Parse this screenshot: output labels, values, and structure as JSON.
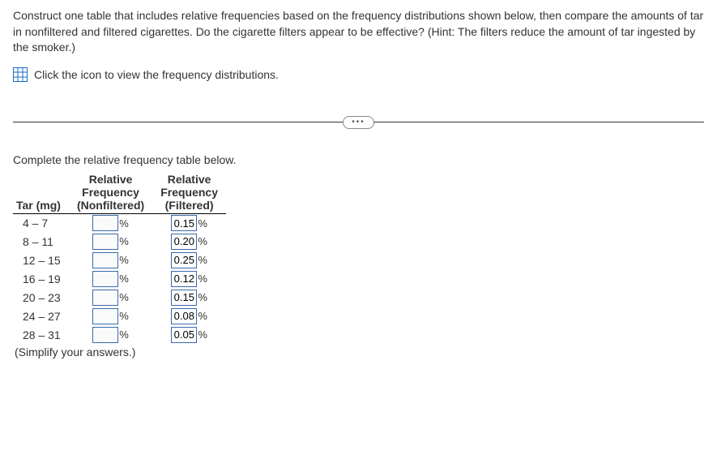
{
  "question": "Construct one table that includes relative frequencies based on the frequency distributions shown below, then compare the amounts of tar in nonfiltered and filtered cigarettes. Do the cigarette filters appear to be effective? (Hint: The filters reduce the amount of tar ingested by the smoker.)",
  "icon_link_text": "Click the icon to view the frequency distributions.",
  "divider_text": "•••",
  "instruction": "Complete the relative frequency table below.",
  "headers": {
    "tar": "Tar (mg)",
    "nonfiltered_l1": "Relative",
    "nonfiltered_l2": "Frequency",
    "nonfiltered_l3": "(Nonfiltered)",
    "filtered_l1": "Relative",
    "filtered_l2": "Frequency",
    "filtered_l3": "(Filtered)"
  },
  "rows": [
    {
      "range": "4 – 7",
      "nonfiltered": "",
      "filtered": "0.15"
    },
    {
      "range": "8 – 11",
      "nonfiltered": "",
      "filtered": "0.20"
    },
    {
      "range": "12 – 15",
      "nonfiltered": "",
      "filtered": "0.25"
    },
    {
      "range": "16 – 19",
      "nonfiltered": "",
      "filtered": "0.12"
    },
    {
      "range": "20 – 23",
      "nonfiltered": "",
      "filtered": "0.15"
    },
    {
      "range": "24 – 27",
      "nonfiltered": "",
      "filtered": "0.08"
    },
    {
      "range": "28 – 31",
      "nonfiltered": "",
      "filtered": "0.05"
    }
  ],
  "percent": "%",
  "simplify": "(Simplify your answers.)"
}
